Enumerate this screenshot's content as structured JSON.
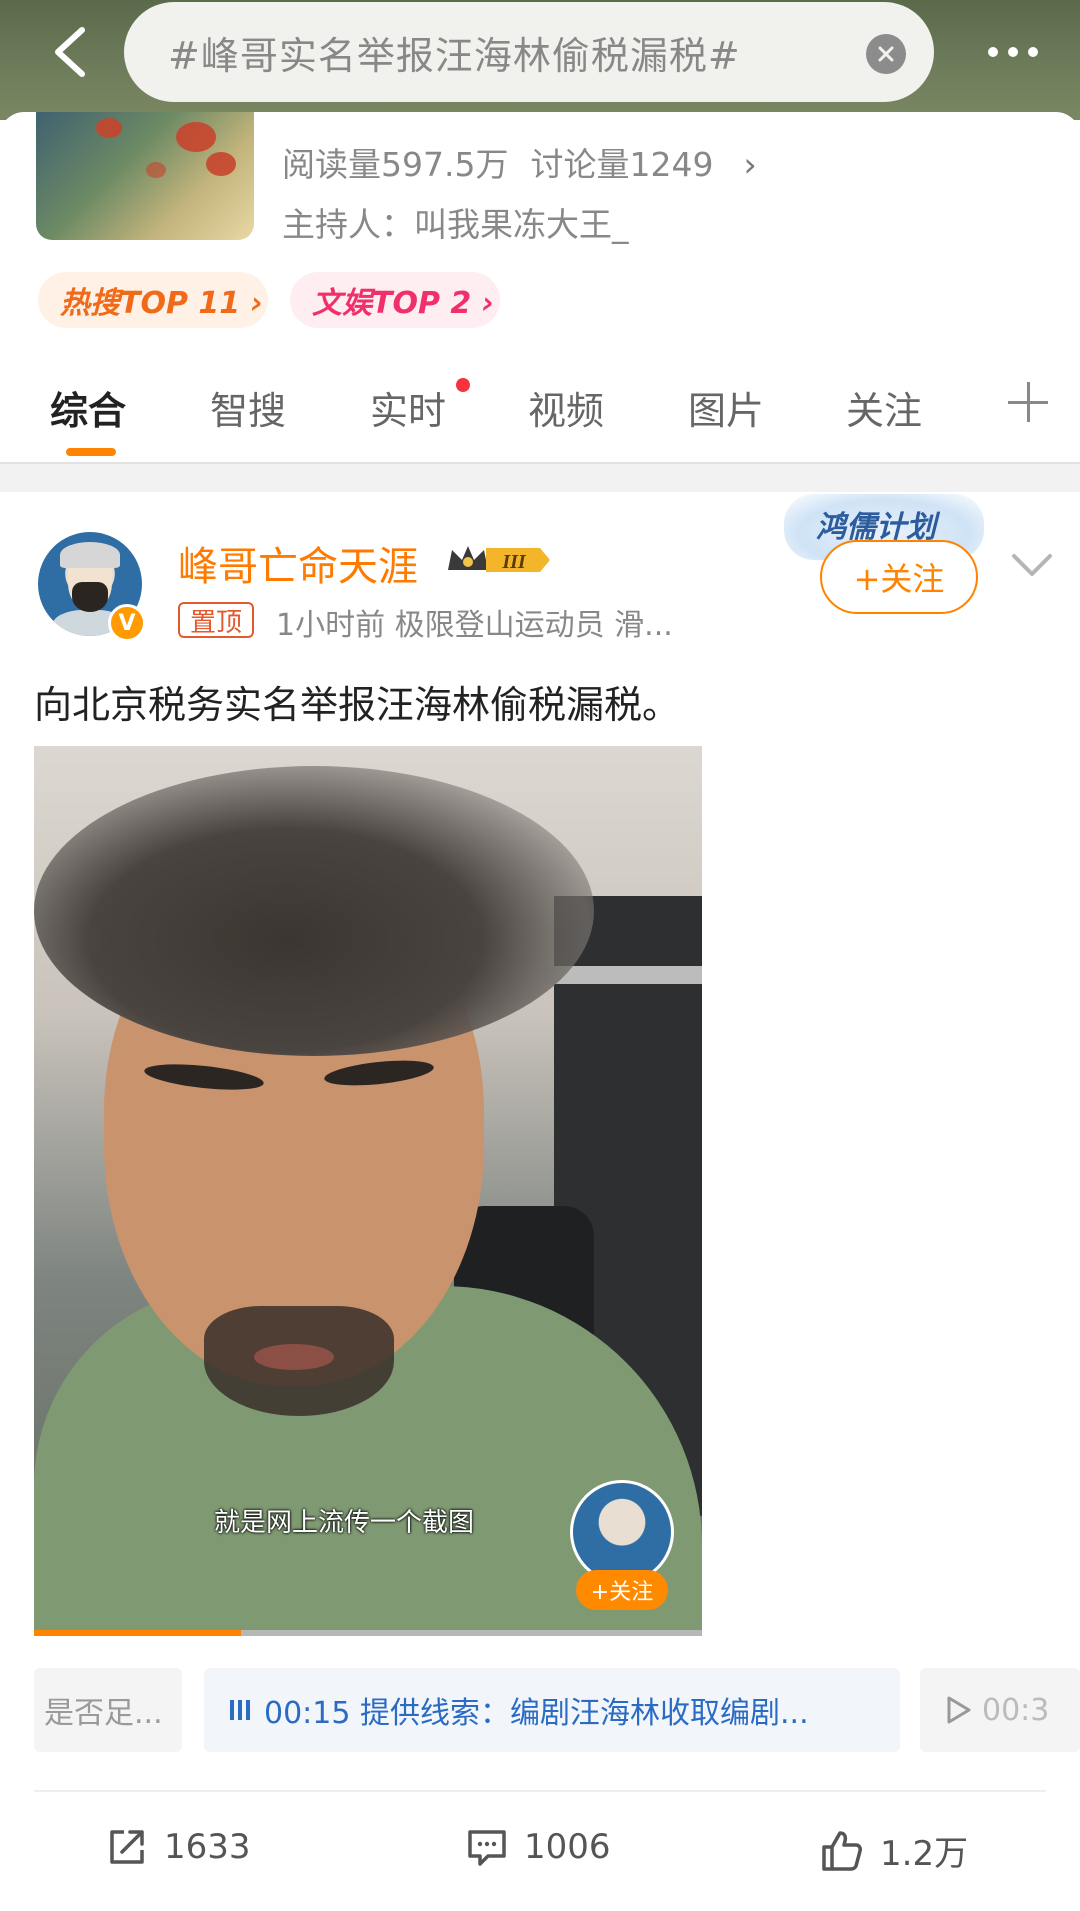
{
  "topbar": {
    "search_query": "#峰哥实名举报汪海林偷税漏税#"
  },
  "topic": {
    "stats_read": "阅读量597.5万",
    "stats_discuss": "讨论量1249",
    "host": "主持人：叫我果冻大王_",
    "rank_hot": "热搜TOP 11 ›",
    "rank_ent": "文娱TOP 2 ›"
  },
  "tabs": [
    {
      "label": "综合"
    },
    {
      "label": "智搜"
    },
    {
      "label": "实时"
    },
    {
      "label": "视频"
    },
    {
      "label": "图片"
    },
    {
      "label": "关注"
    }
  ],
  "post": {
    "username": "峰哥亡命天涯",
    "vip_level": "III",
    "pin_label": "置顶",
    "meta": "1小时前  极限登山运动员 滑...",
    "plan_badge": "鸿儒计划",
    "follow_label": "+关注",
    "text": "向北京税务实名举报汪海林偷税漏税。",
    "video": {
      "subtitle": "就是网上流传一个截图",
      "mini_follow": "+关注",
      "progress": 0.31
    },
    "chapters": {
      "left": "是否足...",
      "mid": "00:15 提供线索：编剧汪海林收取编剧...",
      "right": "00:3"
    },
    "actions": {
      "share_count": "1633",
      "comment_count": "1006",
      "like_count": "1.2万"
    }
  },
  "colors": {
    "accent": "#ff8200",
    "username": "#ff7a00",
    "link_blue": "#2a6bc4"
  }
}
